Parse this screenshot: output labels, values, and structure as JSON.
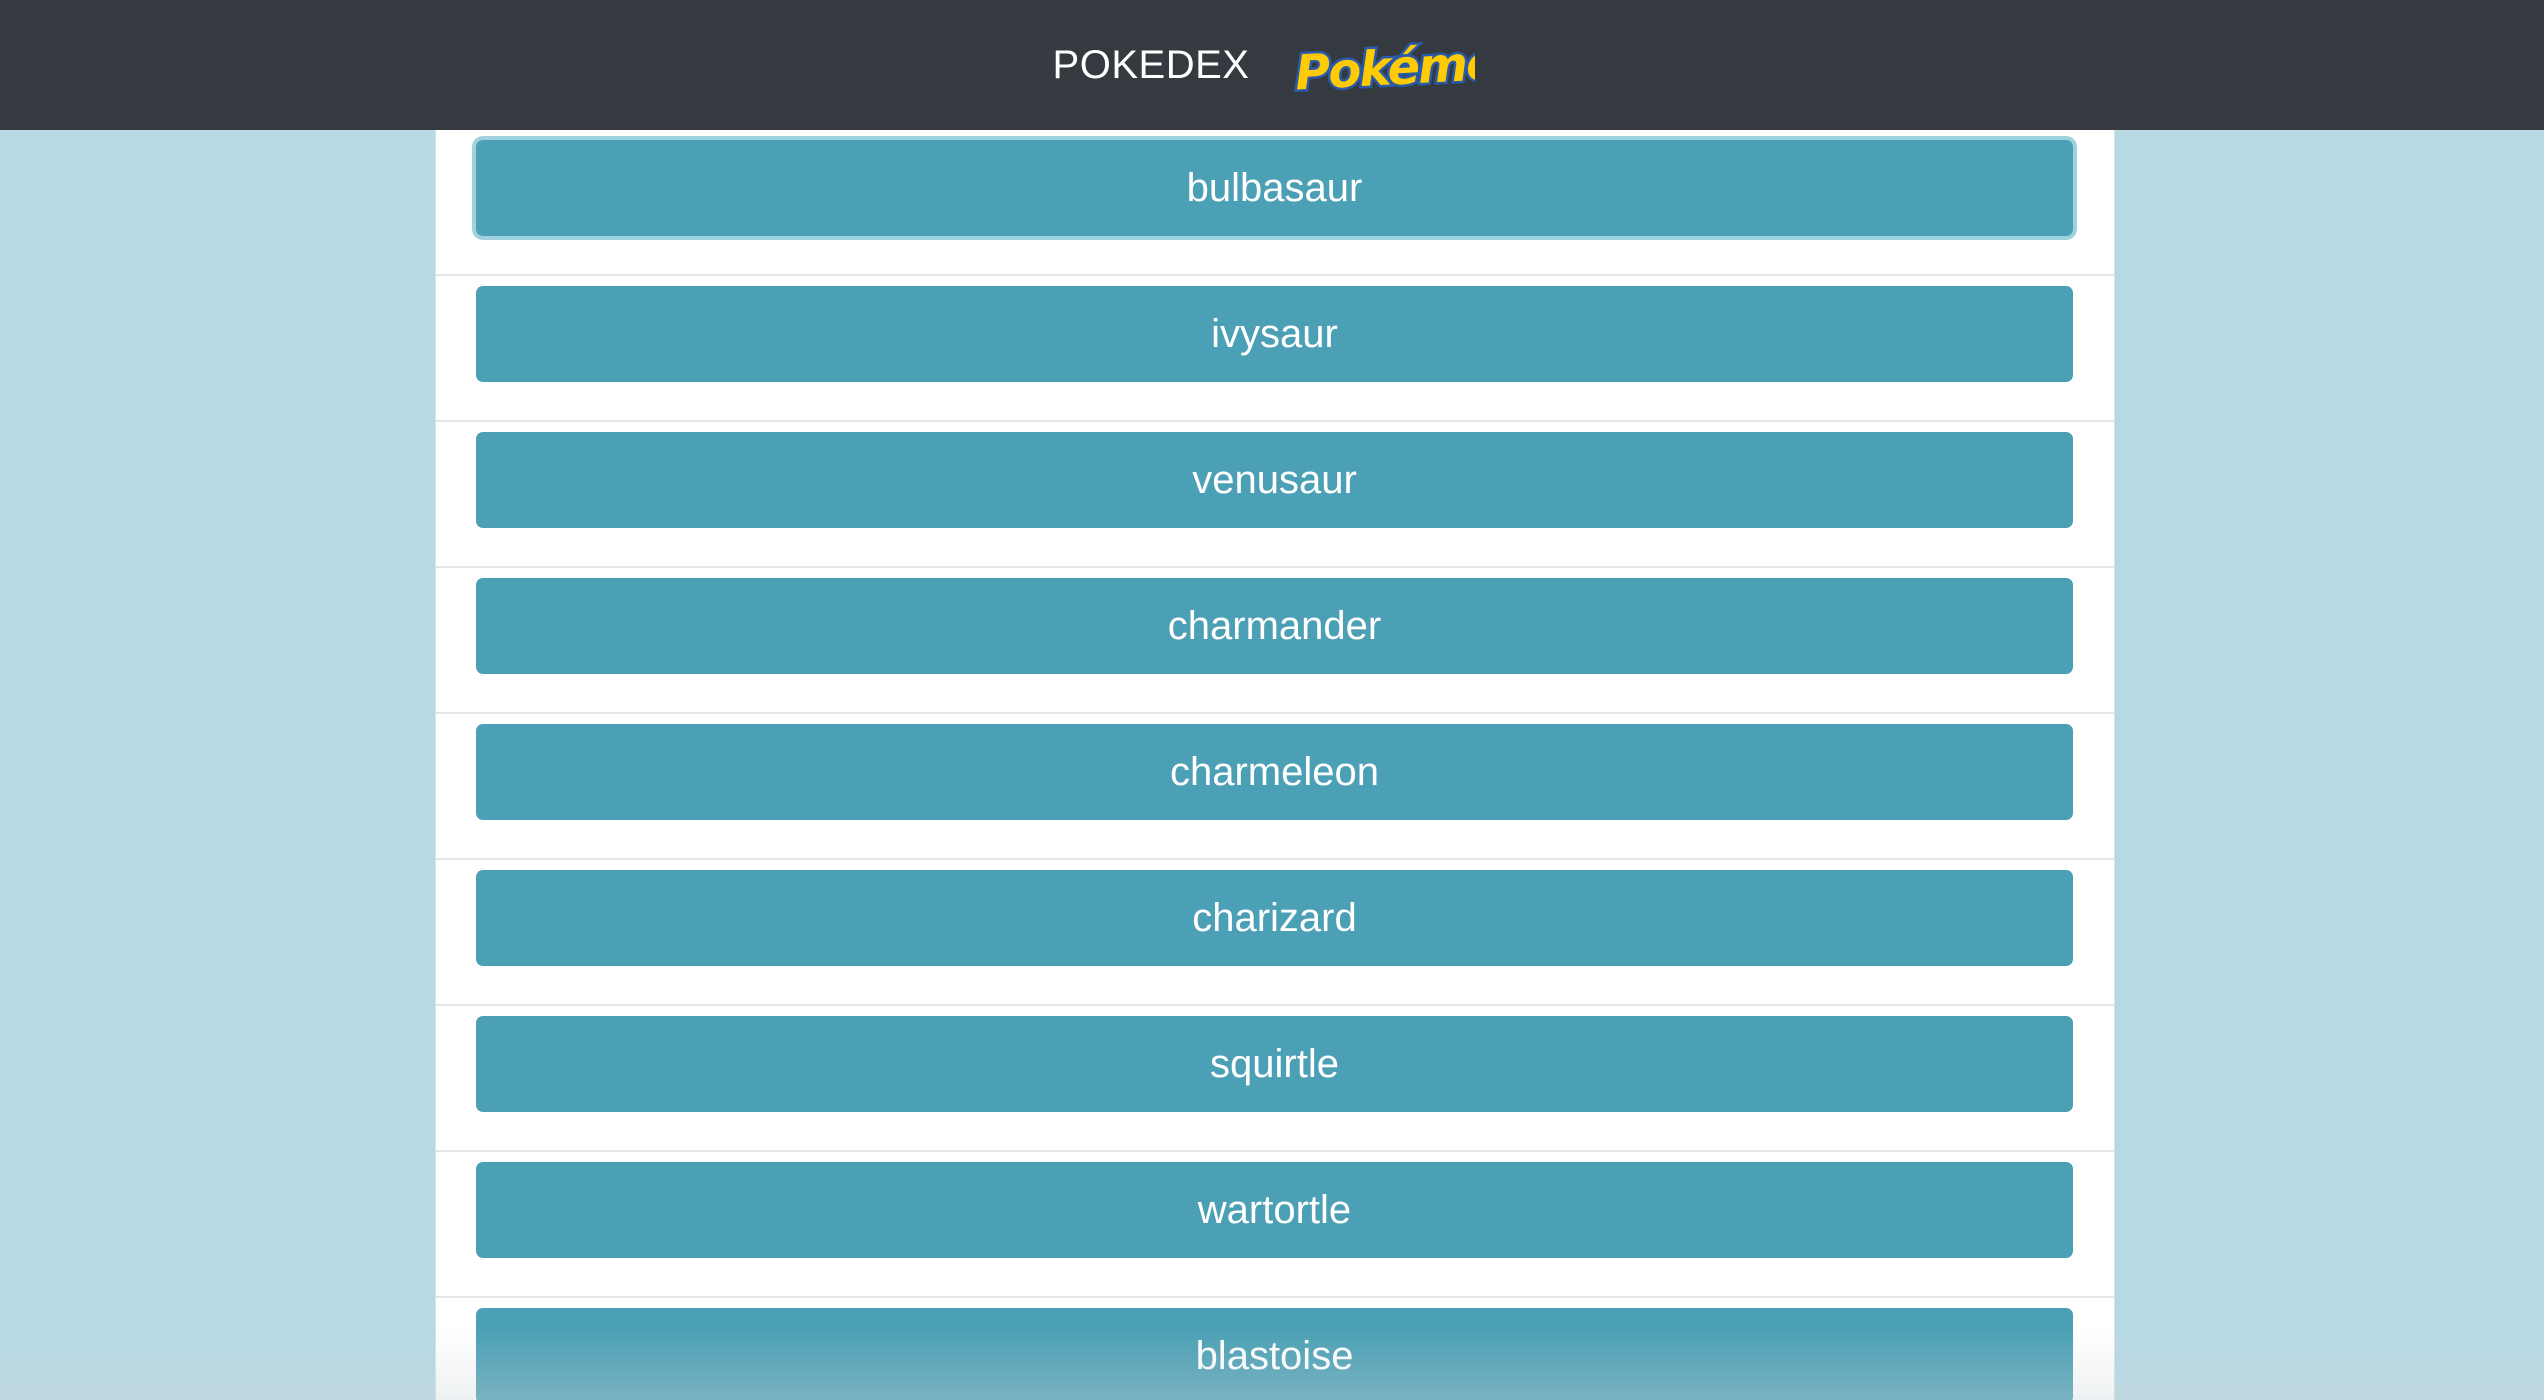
{
  "header": {
    "title": "POKEDEX",
    "logo_text": "Pokémon",
    "background_color": "#343a40",
    "logo_color": "#ffcb05",
    "logo_outline_color": "#2a5aa8"
  },
  "page": {
    "background_color": "#b6d9e4",
    "panel_color": "#ffffff"
  },
  "pokemon_list": {
    "selected_index": 0,
    "items": [
      {
        "name": "bulbasaur"
      },
      {
        "name": "ivysaur"
      },
      {
        "name": "venusaur"
      },
      {
        "name": "charmander"
      },
      {
        "name": "charmeleon"
      },
      {
        "name": "charizard"
      },
      {
        "name": "squirtle"
      },
      {
        "name": "wartortle"
      },
      {
        "name": "blastoise"
      }
    ]
  },
  "colors": {
    "button": "#4ca0b5",
    "button_text": "#ffffff",
    "selected_outline": "#9fd1de",
    "separator": "#e4e7ea"
  }
}
